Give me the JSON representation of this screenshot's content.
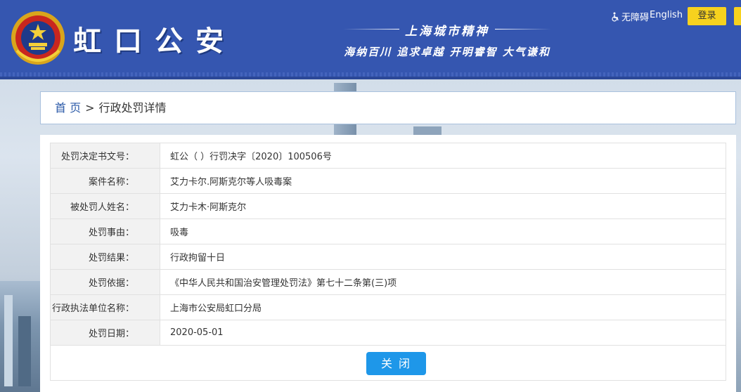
{
  "header": {
    "title": "虹口公安",
    "slogan_title": "上海城市精神",
    "slogan_text": "海纳百川 追求卓越 开明睿智 大气谦和",
    "accessibility_label": "无障碍",
    "english_label": "English",
    "login_label": "登录",
    "colors": {
      "header_bg": "#3556b0",
      "login_bg": "#f7d21e",
      "close_bg": "#1e97e9"
    }
  },
  "breadcrumb": {
    "home": "首 页",
    "separator": ">",
    "current": "行政处罚详情"
  },
  "details": [
    {
      "label": "处罚决定书文号：",
      "value": "虹公（ ）行罚决字〔2020〕100506号"
    },
    {
      "label": "案件名称：",
      "value": "艾力卡尔.阿斯克尔等人吸毒案"
    },
    {
      "label": "被处罚人姓名：",
      "value": "艾力卡木·阿斯克尔"
    },
    {
      "label": "处罚事由：",
      "value": "吸毒"
    },
    {
      "label": "处罚结果：",
      "value": "行政拘留十日"
    },
    {
      "label": "处罚依据：",
      "value": "《中华人民共和国治安管理处罚法》第七十二条第(三)项"
    },
    {
      "label": "行政执法单位名称：",
      "value": "上海市公安局虹口分局"
    },
    {
      "label": "处罚日期：",
      "value": "2020-05-01"
    }
  ],
  "close_label": "关 闭"
}
